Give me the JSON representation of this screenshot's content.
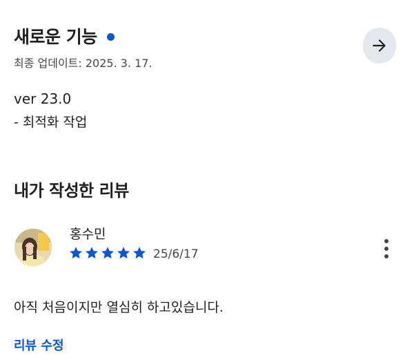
{
  "whats_new": {
    "title": "새로운 기능",
    "updated": "최종 업데이트: 2025. 3. 17.",
    "notes": [
      "ver 23.0",
      "- 최적화 작업"
    ]
  },
  "my_review": {
    "section_title": "내가 작성한 리뷰",
    "reviewer_name": "홍수민",
    "rating": 5,
    "rating_max": 5,
    "date": "25/6/17",
    "text": "아직 처음이지만 열심히 하고있습니다.",
    "edit_label": "리뷰 수정"
  },
  "icons": {
    "arrow": "arrow-right-icon",
    "more": "more-vert-icon",
    "star": "star-icon"
  },
  "colors": {
    "accent": "#0b57d0",
    "arrow_button_bg": "#e3e8ef",
    "text": "#1f1f1f",
    "secondary_text": "#444746"
  }
}
